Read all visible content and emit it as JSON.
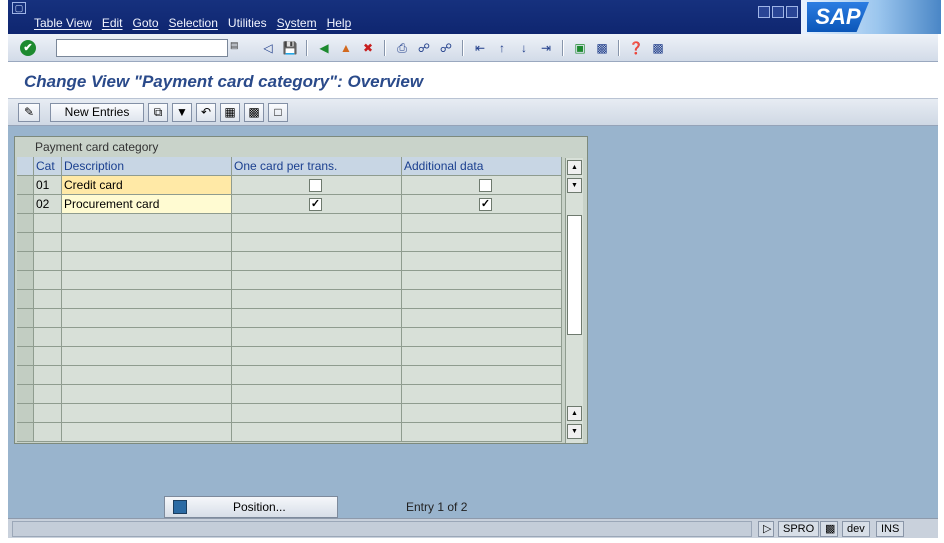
{
  "menubar": {
    "items": [
      "Table View",
      "Edit",
      "Goto",
      "Selection",
      "Utilities",
      "System",
      "Help"
    ],
    "logo": "SAP"
  },
  "toolbar": {
    "command_value": ""
  },
  "title": "Change View \"Payment card category\": Overview",
  "app_toolbar": {
    "new_entries_label": "New Entries"
  },
  "table": {
    "caption": "Payment card category",
    "columns": [
      "Cat",
      "Description",
      "One card per trans.",
      "Additional data"
    ],
    "rows": [
      {
        "cat": "01",
        "description": "Credit card",
        "one_card": false,
        "additional": false
      },
      {
        "cat": "02",
        "description": "Procurement card",
        "one_card": true,
        "additional": true
      }
    ]
  },
  "footer": {
    "position_label": "Position...",
    "entry_text": "Entry 1 of 2"
  },
  "status": {
    "tcode": "SPRO",
    "system": "dev",
    "mode": "INS"
  },
  "colors": {
    "menubar": "#16317e",
    "work_area": "#99b4cd",
    "title": "#2a4a8a"
  }
}
